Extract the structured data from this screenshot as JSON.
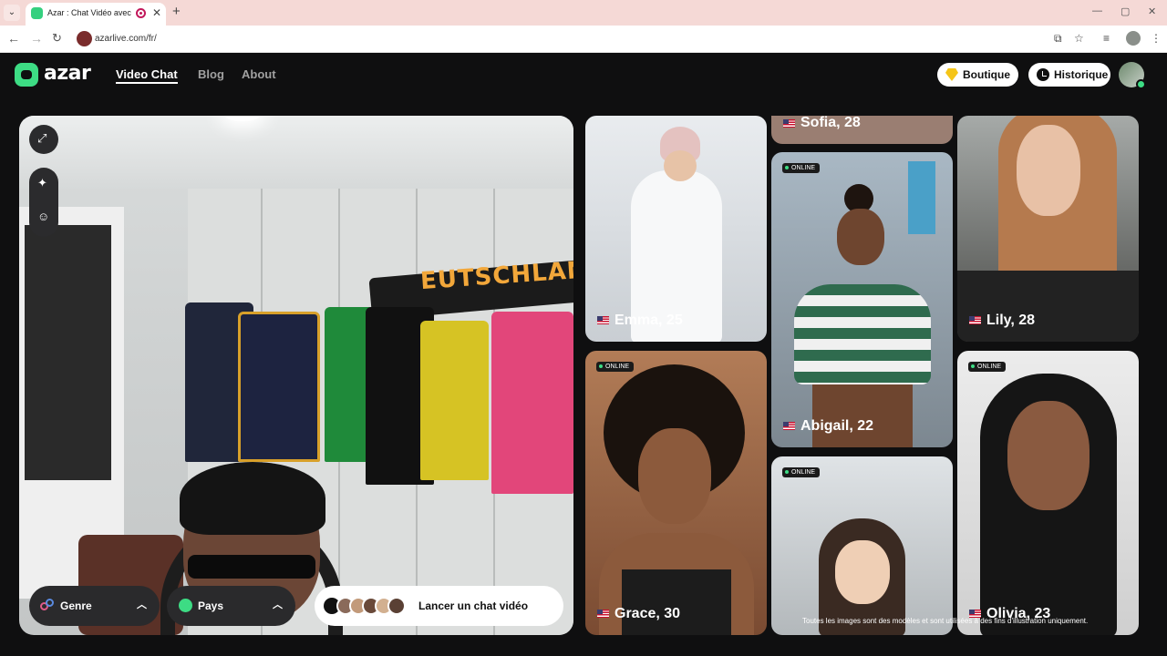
{
  "browser": {
    "tab_title": "Azar : Chat Vidéo avec de n",
    "url": "azarlive.com/fr/",
    "new_tab": "+",
    "close": "✕"
  },
  "header": {
    "logo_text": "azar",
    "nav": [
      "Video Chat",
      "Blog",
      "About"
    ],
    "active_nav": "Video Chat",
    "shop_label": "Boutique",
    "history_label": "Historique"
  },
  "camera": {
    "scarf_text": "EUTSCHLAND",
    "gender_filter": "Genre",
    "country_filter": "Pays",
    "start_label": "Lancer un chat vidéo"
  },
  "profiles": [
    {
      "name": "Sofia, 28",
      "online": false
    },
    {
      "name": "Emma, 25",
      "online": false
    },
    {
      "name": "Abigail, 22",
      "online": true
    },
    {
      "name": "Lily, 28",
      "online": false
    },
    {
      "name": "Grace, 30",
      "online": true
    },
    {
      "name": "Olivia, 23",
      "online": true
    },
    {
      "name": "",
      "online": true
    }
  ],
  "online_label": "ONLINE",
  "disclaimer": "Toutes les images sont des modèles et sont utilisées à des fins d'illustration uniquement.",
  "colors": {
    "brand": "#3ddc84",
    "background": "#0f0f10",
    "online_dot": "#3ddc84"
  }
}
